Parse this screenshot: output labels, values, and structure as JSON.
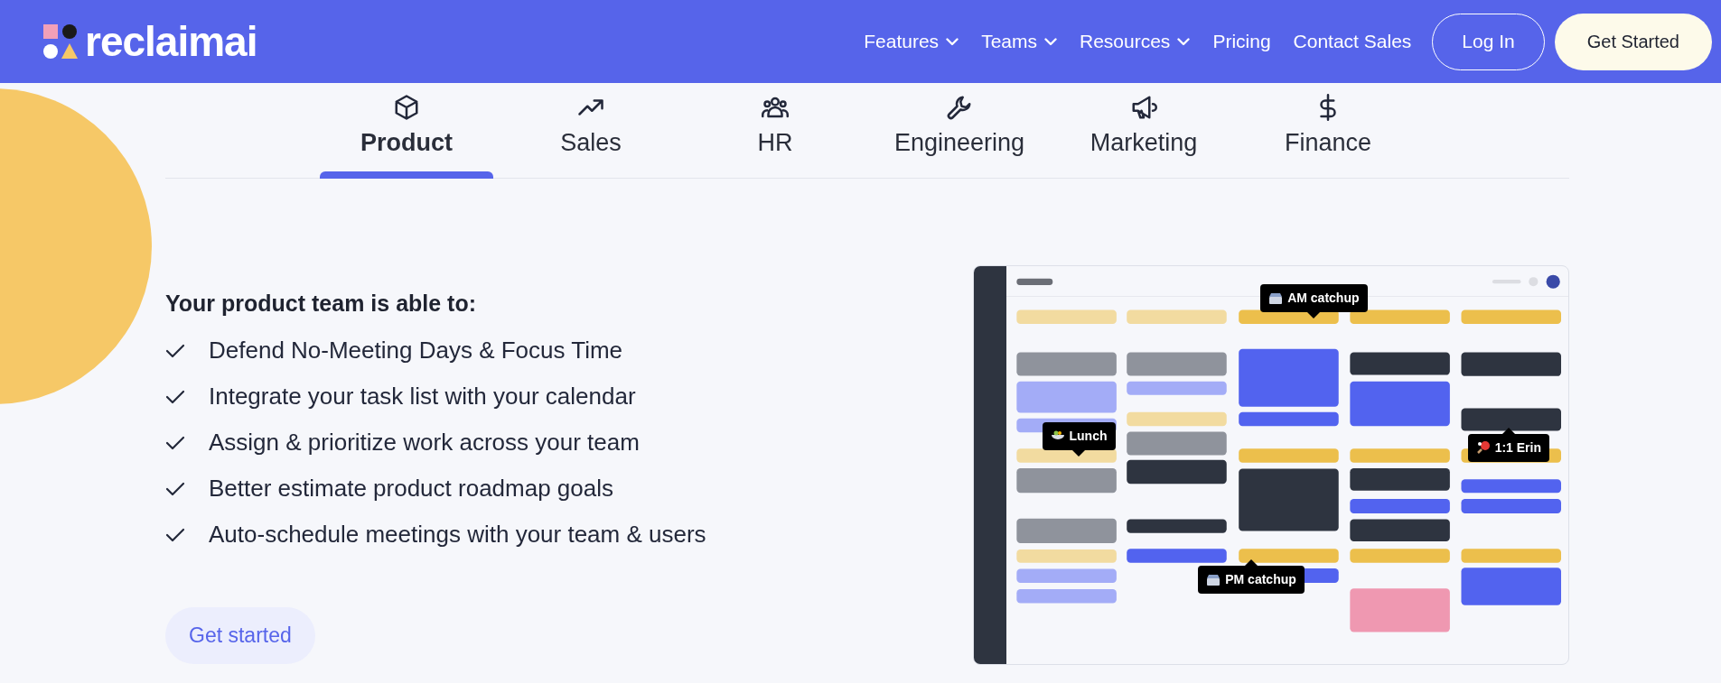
{
  "logo": {
    "text": "reclaimai"
  },
  "nav": {
    "items": [
      {
        "label": "Features",
        "dropdown": true
      },
      {
        "label": "Teams",
        "dropdown": true
      },
      {
        "label": "Resources",
        "dropdown": true
      },
      {
        "label": "Pricing",
        "dropdown": false
      },
      {
        "label": "Contact Sales",
        "dropdown": false
      }
    ],
    "login": "Log In",
    "cta": "Get Started"
  },
  "tabs": [
    {
      "label": "Product",
      "selected": true
    },
    {
      "label": "Sales",
      "selected": false
    },
    {
      "label": "HR",
      "selected": false
    },
    {
      "label": "Engineering",
      "selected": false
    },
    {
      "label": "Marketing",
      "selected": false
    },
    {
      "label": "Finance",
      "selected": false
    }
  ],
  "panel": {
    "heading": "Your product team is able to:",
    "benefits": [
      "Defend No-Meeting Days & Focus Time",
      "Integrate your task list with your calendar",
      "Assign & prioritize work across your team",
      "Better estimate product roadmap goals",
      "Auto-schedule meetings with your team & users"
    ],
    "button": "Get started"
  },
  "calendar_preview": {
    "callouts": [
      {
        "text": "AM catchup"
      },
      {
        "text": "Lunch"
      },
      {
        "text": "1:1 Erin"
      },
      {
        "text": "PM catchup"
      }
    ]
  }
}
